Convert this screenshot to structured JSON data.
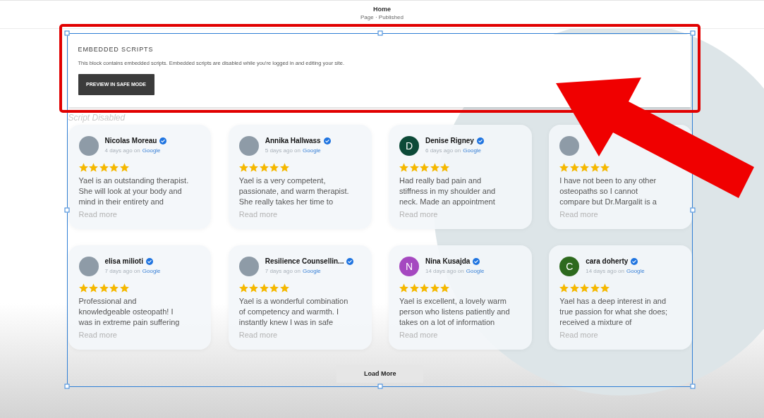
{
  "header": {
    "title": "Home",
    "status": "Page · Published"
  },
  "block": {
    "selected": true
  },
  "embed_notice": {
    "title": "EMBEDDED SCRIPTS",
    "message": "This block contains embedded scripts. Embedded scripts are disabled while you're logged in and editing your site.",
    "button": "PREVIEW IN SAFE MODE"
  },
  "disabled_label": "Script Disabled",
  "reviews": [
    {
      "avatar": {
        "kind": "photo"
      },
      "name": "Nicolas Moreau",
      "verified": true,
      "time": "4 days ago on",
      "source": "Google",
      "stars": 5,
      "text": "Yael is an outstanding therapist.\nShe will look at your body and\nmind in their entirety and",
      "read_more": "Read more"
    },
    {
      "avatar": {
        "kind": "photo"
      },
      "name": "Annika Hallwass",
      "verified": true,
      "time": "5 days ago on",
      "source": "Google",
      "stars": 5,
      "text": "Yael is a very competent,\npassionate, and warm therapist.\nShe really takes her time to",
      "read_more": "Read more"
    },
    {
      "avatar": {
        "kind": "letter",
        "letter": "D",
        "color": "#0d4a38"
      },
      "name": "Denise Rigney",
      "verified": true,
      "time": "6 days ago on",
      "source": "Google",
      "stars": 5,
      "text": "Had really bad pain and\nstiffness in my shoulder and\nneck. Made an appointment",
      "read_more": "Read more"
    },
    {
      "avatar": {
        "kind": "photo"
      },
      "stars": 5,
      "text": "I have not been to any other\nosteopaths so I cannot\ncompare but Dr.Margalit is a",
      "read_more": "Read more"
    },
    {
      "avatar": {
        "kind": "photo"
      },
      "name": "elisa milioti",
      "verified": true,
      "time": "7 days ago on",
      "source": "Google",
      "stars": 5,
      "text": "Professional and\nknowledgeable osteopath! I\nwas in extreme pain suffering",
      "read_more": "Read more"
    },
    {
      "avatar": {
        "kind": "photo"
      },
      "name": "Resilience Counsellin...",
      "verified": true,
      "time": "7 days ago on",
      "source": "Google",
      "stars": 5,
      "text": "Yael is a wonderful combination\nof competency and warmth. I\ninstantly knew I was in safe",
      "read_more": "Read more"
    },
    {
      "avatar": {
        "kind": "letter",
        "letter": "N",
        "color": "#a548c0"
      },
      "name": "Nina Kusajda",
      "verified": true,
      "time": "14 days ago on",
      "source": "Google",
      "stars": 5,
      "text": "Yael is excellent, a lovely warm\nperson who listens patiently and\ntakes on a lot of information",
      "read_more": "Read more"
    },
    {
      "avatar": {
        "kind": "letter",
        "letter": "C",
        "color": "#2d6a1e"
      },
      "name": "cara doherty",
      "verified": true,
      "time": "14 days ago on",
      "source": "Google",
      "stars": 5,
      "text": "Yael has a deep interest in and\ntrue passion for what she does;\nreceived a mixture of",
      "read_more": "Read more"
    }
  ],
  "load_more": "Load More"
}
